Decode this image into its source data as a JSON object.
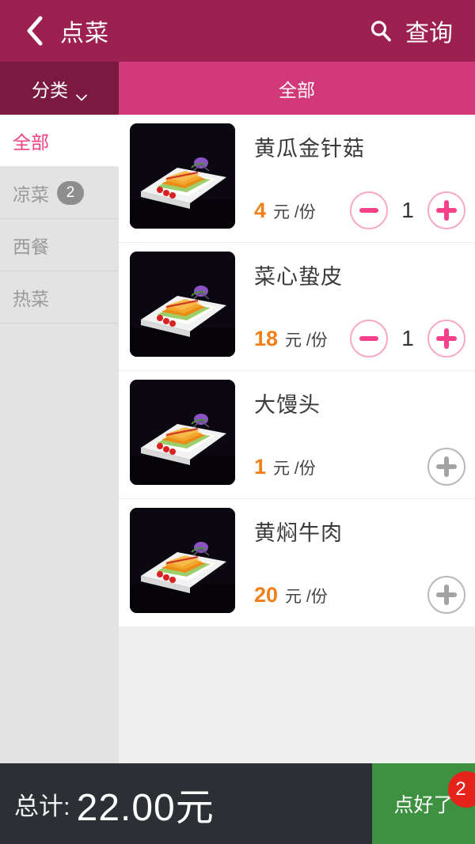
{
  "header": {
    "back_icon": "chevron-left-icon",
    "title": "点菜",
    "search_icon": "search-icon",
    "search_label": "查询"
  },
  "tabbar": {
    "category_label": "分类",
    "category_caret_icon": "chevron-down-icon",
    "all_label": "全部"
  },
  "sidebar": {
    "items": [
      {
        "label": "全部",
        "badge": "",
        "active": true
      },
      {
        "label": "凉菜",
        "badge": "2",
        "active": false
      },
      {
        "label": "西餐",
        "badge": "",
        "active": false
      },
      {
        "label": "热菜",
        "badge": "",
        "active": false
      }
    ]
  },
  "dishes": [
    {
      "name": "黄瓜金针菇",
      "price": "4",
      "unit": "元 /份",
      "qty": "1",
      "has_qty": true,
      "image_alt": "dish-photo"
    },
    {
      "name": "菜心蛰皮",
      "price": "18",
      "unit": "元 /份",
      "qty": "1",
      "has_qty": true,
      "image_alt": "dish-photo"
    },
    {
      "name": "大馒头",
      "price": "1",
      "unit": "元 /份",
      "qty": "0",
      "has_qty": false,
      "image_alt": "dish-photo"
    },
    {
      "name": "黄焖牛肉",
      "price": "20",
      "unit": "元 /份",
      "qty": "0",
      "has_qty": false,
      "image_alt": "dish-photo"
    }
  ],
  "footer": {
    "total_label": "总计:",
    "total_value": "22.00元",
    "confirm_label": "点好了",
    "confirm_badge": "2"
  },
  "colors": {
    "header_bg": "#9c2150",
    "tab_category_bg": "#7a1a41",
    "tab_all_bg": "#d1397a",
    "accent_pink": "#ef4080",
    "price_orange": "#f08019",
    "footer_bg": "#2c2f33",
    "confirm_green": "#3d9140",
    "badge_red": "#e5231b"
  }
}
